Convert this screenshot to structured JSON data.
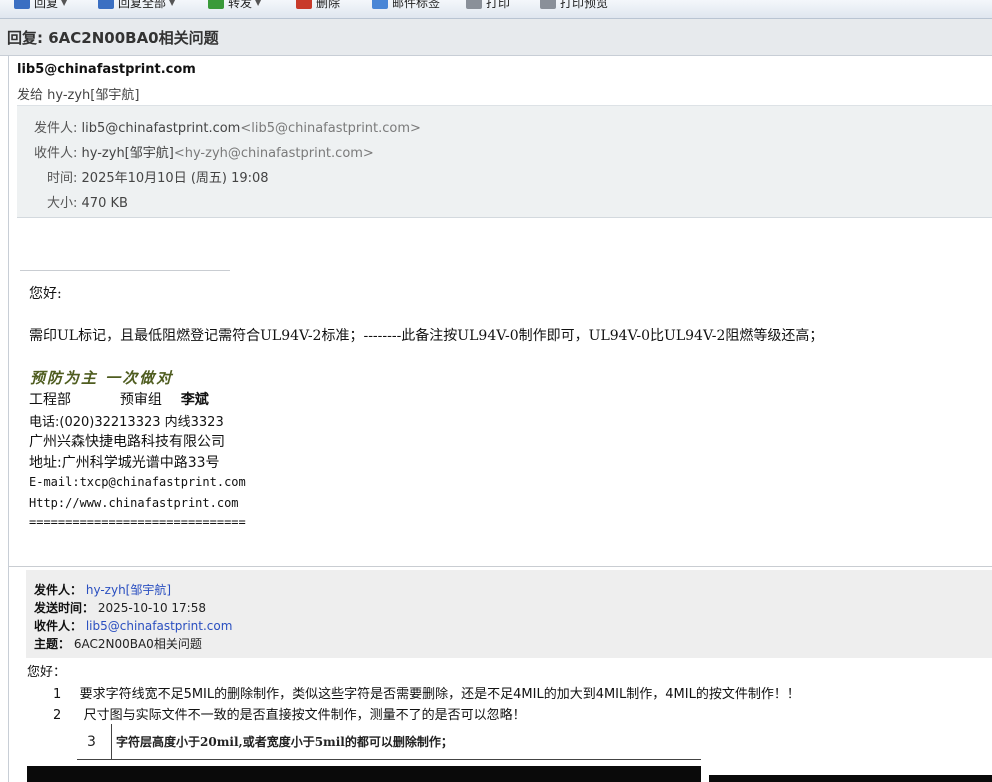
{
  "toolbar": {
    "items": [
      {
        "label": "回复",
        "icon": "reply-icon",
        "dropdown": true
      },
      {
        "label": "回复全部",
        "icon": "reply-all-icon",
        "dropdown": true
      },
      {
        "label": "转发",
        "icon": "forward-icon",
        "dropdown": true
      },
      {
        "label": "删除",
        "icon": "delete-icon",
        "dropdown": false
      },
      {
        "label": "邮件标签",
        "icon": "tag-icon",
        "dropdown": false
      },
      {
        "label": "打印",
        "icon": "print-icon",
        "dropdown": false
      },
      {
        "label": "打印预览",
        "icon": "print-preview-icon",
        "dropdown": false
      }
    ]
  },
  "subject": "回复: 6AC2N00BA0相关问题",
  "sender_display": "lib5@chinafastprint.com",
  "to_line": "发给 hy-zyh[邹宇航]",
  "headers": {
    "from_label": "发件人:",
    "from_name": "lib5@chinafastprint.com",
    "from_email": "<lib5@chinafastprint.com>",
    "to_label": "收件人:",
    "to_name": "hy-zyh[邹宇航]",
    "to_email": "<hy-zyh@chinafastprint.com>",
    "time_label": "时间:",
    "time_value": "2025年10月10日 (周五) 19:08",
    "size_label": "大小:",
    "size_value": "470 KB"
  },
  "body": {
    "greeting": "您好:",
    "message": "需印UL标记，且最低阻燃登记需符合UL94V-2标准；--------此备注按UL94V-0制作即可，UL94V-0比UL94V-2阻燃等级还高；"
  },
  "signature": {
    "slogan": "预防为主  一次做对",
    "department": "工程部",
    "team": "预审组",
    "name": "李斌",
    "phone": "电话:(020)32213323  内线3323",
    "company": "广州兴森快捷电路科技有限公司",
    "address": "地址:广州科学城光谱中路33号",
    "email": "E-mail:txcp@chinafastprint.com",
    "website": "Http://www.chinafastprint.com",
    "rule": "=============================="
  },
  "quoted": {
    "from_label": "发件人：",
    "from_value": "hy-zyh[邹宇航]",
    "sent_label": "发送时间：",
    "sent_value": "2025-10-10 17:58",
    "to_label": "收件人：",
    "to_value": "lib5@chinafastprint.com",
    "subject_label": "主题：",
    "subject_value": "6AC2N00BA0相关问题",
    "greeting": "您好：",
    "items": [
      {
        "num": "1",
        "text": "要求字符线宽不足5MIL的删除制作，类似这些字符是否需要删除，还是不足4MIL的加大到4MIL制作，4MIL的按文件制作！！"
      },
      {
        "num": "2",
        "text": "尺寸图与实际文件不一致的是否直接按文件制作，测量不了的是否可以忽略！"
      },
      {
        "num": "3",
        "text": "字符层高度小于20mil,或者宽度小于5mil的都可以删除制作；"
      }
    ]
  },
  "colors": {
    "toolbar_bg": "#dfe6ef",
    "subject_bar_bg": "#e7eaed",
    "header_box_bg": "#eef1f2",
    "quote_bg": "#eeeeee",
    "link": "#2a4fc0",
    "slogan": "#4f5d20"
  }
}
